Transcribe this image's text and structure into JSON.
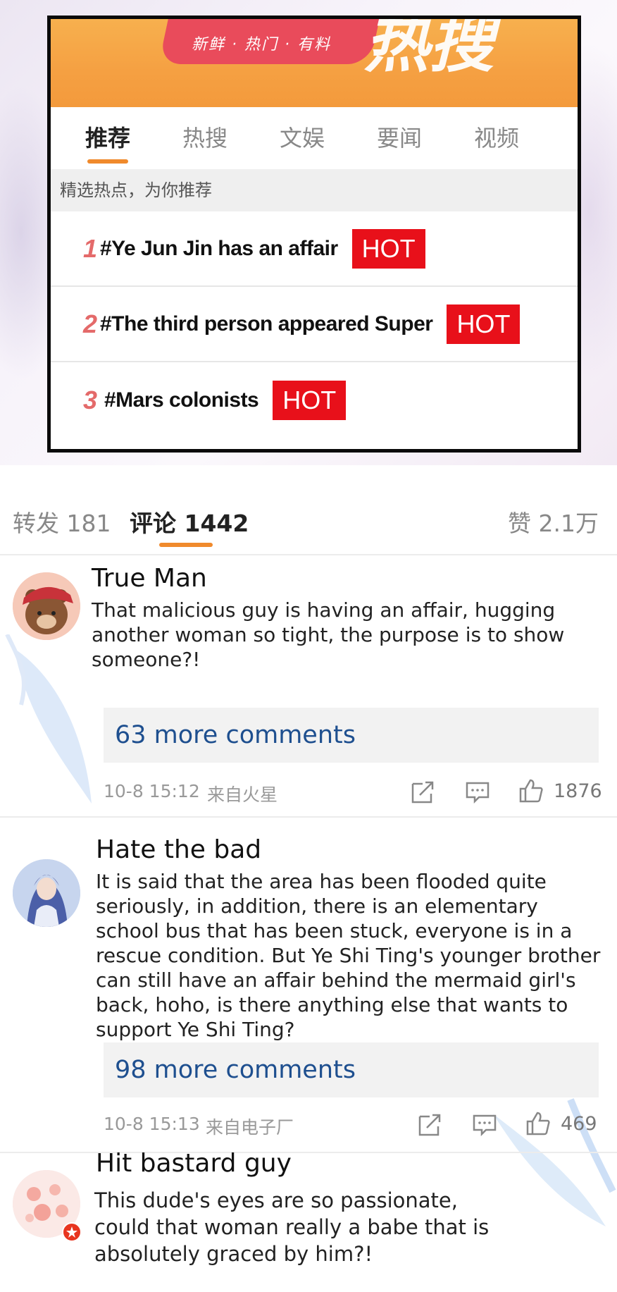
{
  "hot_card": {
    "banner_tagline": "新鲜 · 热门 · 有料",
    "banner_title": "热搜",
    "tabs": [
      "推荐",
      "热搜",
      "文娱",
      "要闻",
      "视频"
    ],
    "subheader": "精选热点，为你推荐",
    "items": [
      {
        "rank": "1",
        "title": "#Ye Jun Jin has an affair",
        "badge": "HOT"
      },
      {
        "rank": "2",
        "title": "#The third person appeared Super",
        "badge": "HOT"
      },
      {
        "rank": "3",
        "title": "#Mars colonists",
        "badge": "HOT"
      }
    ],
    "colors": {
      "banner": "#f5a042",
      "badge": "#e8101a",
      "accent": "#f08a2c"
    }
  },
  "action_bar": {
    "repost": "转发 181",
    "comments": "评论 1442",
    "likes": "赞 2.1万"
  },
  "comments": [
    {
      "name": "True Man",
      "text": "That malicious guy is having an affair, hugging another woman so tight, the purpose is to show someone?!",
      "more": "63 more comments",
      "time": "10-8 15:12",
      "source": "来自火星",
      "like_count": "1876",
      "avatar_icon": "bear-avatar"
    },
    {
      "name": "Hate the bad",
      "text": "It is said that the area has been flooded quite seriously, in addition, there is an elementary school bus that has been stuck, everyone is in a rescue condition. But Ye Shi Ting's younger brother can still have an affair behind the mermaid girl's back, hoho, is there anything else that wants to support Ye Shi Ting?",
      "more": "98 more comments",
      "time": "10-8 15:13",
      "source": "来自电子厂",
      "like_count": "469",
      "avatar_icon": "fairy-avatar"
    },
    {
      "name": "Hit bastard guy",
      "text": "This dude's eyes are so passionate, could that woman really a babe that is absolutely graced by him?!",
      "avatar_icon": "peach-avatar"
    }
  ]
}
